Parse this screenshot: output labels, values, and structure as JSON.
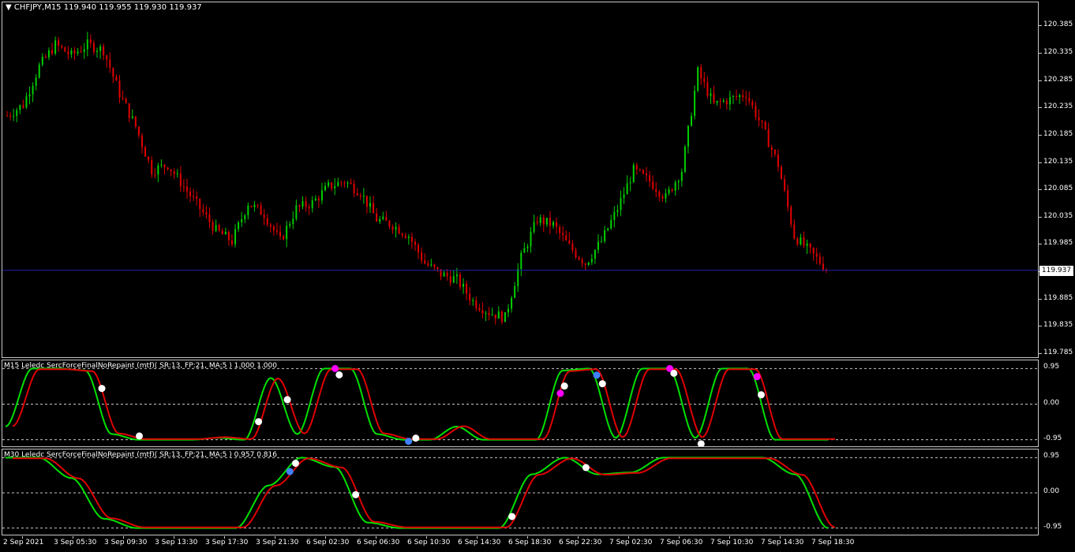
{
  "main_chart": {
    "title": "CHFJPY,M15  119.940 119.955 119.930 119.937",
    "current_price": "119.937",
    "price_labels": [
      "120.385",
      "120.335",
      "120.285",
      "120.235",
      "120.185",
      "120.135",
      "120.085",
      "120.035",
      "119.985",
      "119.935",
      "119.885",
      "119.835",
      "119.785"
    ],
    "colors": {
      "background": "#000000",
      "bull": "#00d000",
      "bear": "#e00000",
      "price_line": "#2020b0",
      "border": "#c8c8c8"
    }
  },
  "indicator1": {
    "title": "M15 Leledc SercForceFinalNoRepaint (mtf)( SR:13, FP:21, MA:5 ) 1.000 1.000",
    "levels": [
      "0.95",
      "0.00",
      "-0.95"
    ]
  },
  "indicator2": {
    "title": "M30 Leledc SercForceFinalNoRepaint (mtf)( SR:13, FP:21, MA:5 ) 0.957 0.816",
    "levels": [
      "0.95",
      "0.00",
      "-0.95"
    ]
  },
  "time_labels": [
    "2 Sep 2021",
    "3 Sep 05:30",
    "3 Sep 09:30",
    "3 Sep 13:30",
    "3 Sep 17:30",
    "3 Sep 21:30",
    "6 Sep 02:30",
    "6 Sep 06:30",
    "6 Sep 10:30",
    "6 Sep 14:30",
    "6 Sep 18:30",
    "6 Sep 22:30",
    "7 Sep 02:30",
    "7 Sep 06:30",
    "7 Sep 10:30",
    "7 Sep 14:30",
    "7 Sep 18:30"
  ],
  "chart_data": {
    "type": "candlestick",
    "symbol": "CHFJPY",
    "timeframe": "M15",
    "ylim": [
      119.785,
      120.41
    ],
    "open": 119.94,
    "high": 119.955,
    "low": 119.93,
    "close": 119.937,
    "price_path": [
      120.22,
      120.24,
      120.31,
      120.35,
      120.33,
      120.35,
      120.34,
      120.26,
      120.2,
      120.12,
      120.13,
      120.09,
      120.05,
      120.01,
      119.99,
      120.06,
      120.04,
      119.99,
      120.05,
      120.06,
      120.09,
      120.1,
      120.08,
      120.03,
      120.02,
      120.0,
      119.95,
      119.93,
      119.92,
      119.88,
      119.86,
      119.85,
      119.96,
      120.03,
      120.02,
      119.98,
      119.95,
      119.99,
      120.05,
      120.12,
      120.1,
      120.07,
      120.12,
      120.3,
      120.24,
      120.25,
      120.26,
      120.2,
      120.13,
      120.0,
      119.97,
      119.94
    ],
    "indicator1_green": [
      -0.6,
      0.95,
      0.95,
      0.9,
      -0.8,
      -0.95,
      -0.95,
      -0.95,
      -0.9,
      -0.95,
      0.7,
      -0.8,
      0.95,
      0.95,
      -0.8,
      -0.95,
      -0.95,
      -0.6,
      -0.95,
      -0.95,
      -0.95,
      0.9,
      0.95,
      -0.9,
      0.95,
      0.95,
      -0.9,
      0.95,
      0.95,
      -0.95,
      -0.95,
      -0.95
    ],
    "indicator2_green": [
      0.95,
      0.95,
      0.4,
      -0.7,
      -0.95,
      -0.95,
      -0.95,
      -0.95,
      0.2,
      0.95,
      0.7,
      -0.8,
      -0.95,
      -0.95,
      -0.95,
      -0.95,
      0.5,
      0.95,
      0.5,
      0.55,
      0.95,
      0.95,
      0.95,
      0.95,
      0.5,
      -0.95
    ]
  }
}
